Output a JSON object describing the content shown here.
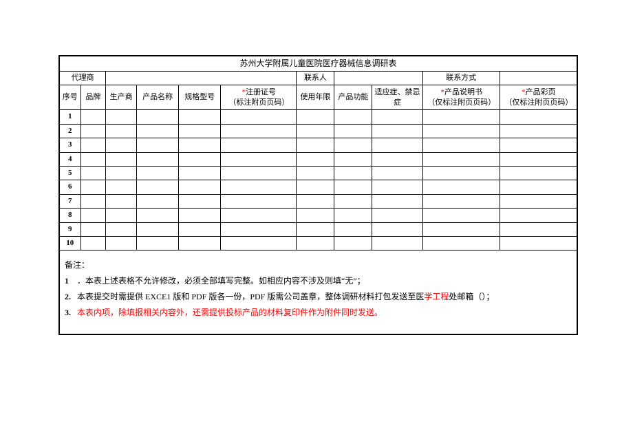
{
  "title": "苏州大学附属儿童医院医疗器械信息调研表",
  "header": {
    "agent_label": "代理商",
    "agent_value": "",
    "contact_label": "联系人",
    "contact_value": "",
    "phone_label": "联系方式",
    "phone_value": ""
  },
  "columns": {
    "c1": "序号",
    "c2": "品牌",
    "c3": "生产商",
    "c4": "产品名称",
    "c5": "规格型号",
    "c6_pre": "注册证号\n（标注附页页码）",
    "c7": "使用年限",
    "c8": "产品功能",
    "c9": "适应症、禁忌症",
    "c10_pre": "产品说明书\n（仅标注附页页码）",
    "c11_pre": "产品彩页\n（仅标注附页页码）"
  },
  "rows": [
    "1",
    "2",
    "3",
    "4",
    "5",
    "6",
    "7",
    "8",
    "9",
    "10"
  ],
  "notes": {
    "head": "备注：",
    "l1_idx": "1",
    "l1": "．本表上述表格不允许修改，必须全部填写完整。如相应内容不涉及则填“无”；",
    "l2_idx": "2.",
    "l2a": "本表提交时需提供 EXCE1 版和 PDF 版各一份，PDF 版需公司盖章，整体调研材料打包发送至医",
    "l2_red": "学工程",
    "l2b": "处邮箱（）；",
    "l3_idx": "3.",
    "l3": "本表内项，除填报相关内容外，还需提供投标产品的材料复印件作为附件同时发送。"
  }
}
